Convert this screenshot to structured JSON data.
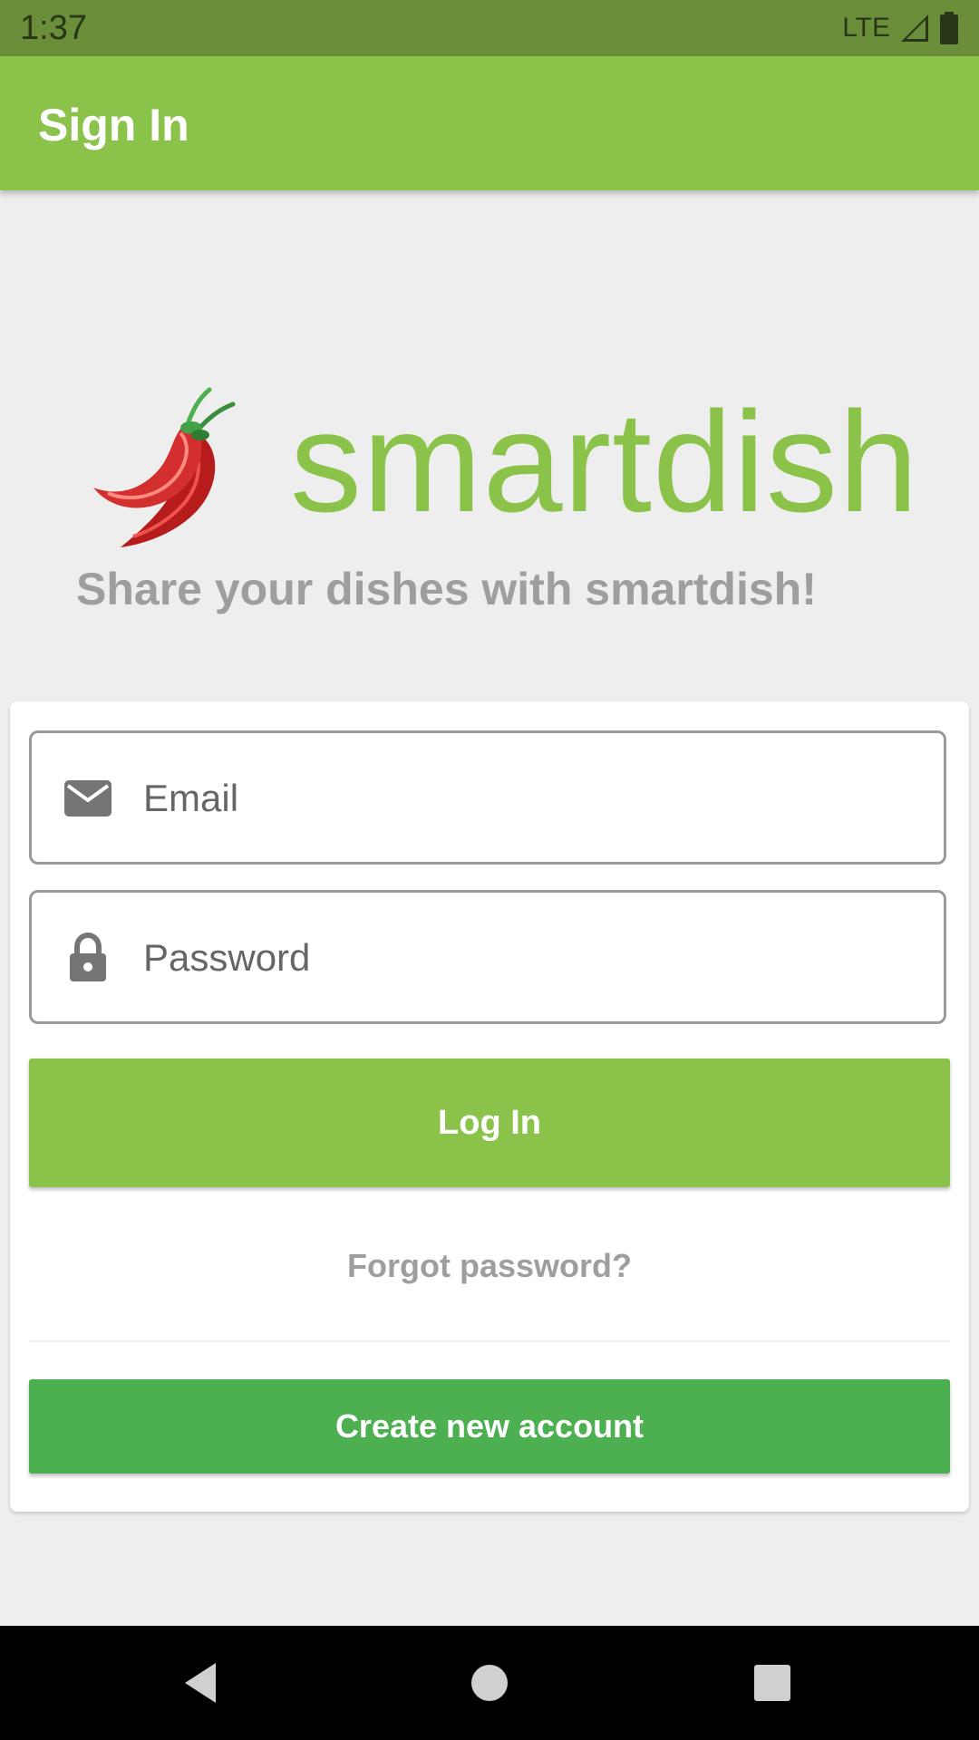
{
  "status_bar": {
    "time": "1:37",
    "network": "LTE",
    "icons": [
      "signal-icon",
      "battery-icon"
    ]
  },
  "app_bar": {
    "title": "Sign In"
  },
  "logo": {
    "image": "chili-pepper-logo",
    "wordmark": "smartdish"
  },
  "tagline": "Share your dishes with smartdish!",
  "form": {
    "email": {
      "icon": "email-icon",
      "placeholder": "Email",
      "value": ""
    },
    "password": {
      "icon": "lock-icon",
      "placeholder": "Password",
      "value": ""
    },
    "login_label": "Log In",
    "forgot_label": "Forgot password?",
    "create_label": "Create new account"
  },
  "nav": {
    "buttons": [
      "back-icon",
      "home-icon",
      "recents-icon"
    ]
  },
  "colors": {
    "status_bar": "#6b8e3a",
    "primary": "#8bc34a",
    "create_button": "#4caf50",
    "background": "#eeeeee",
    "muted_text": "#9e9e9e"
  }
}
